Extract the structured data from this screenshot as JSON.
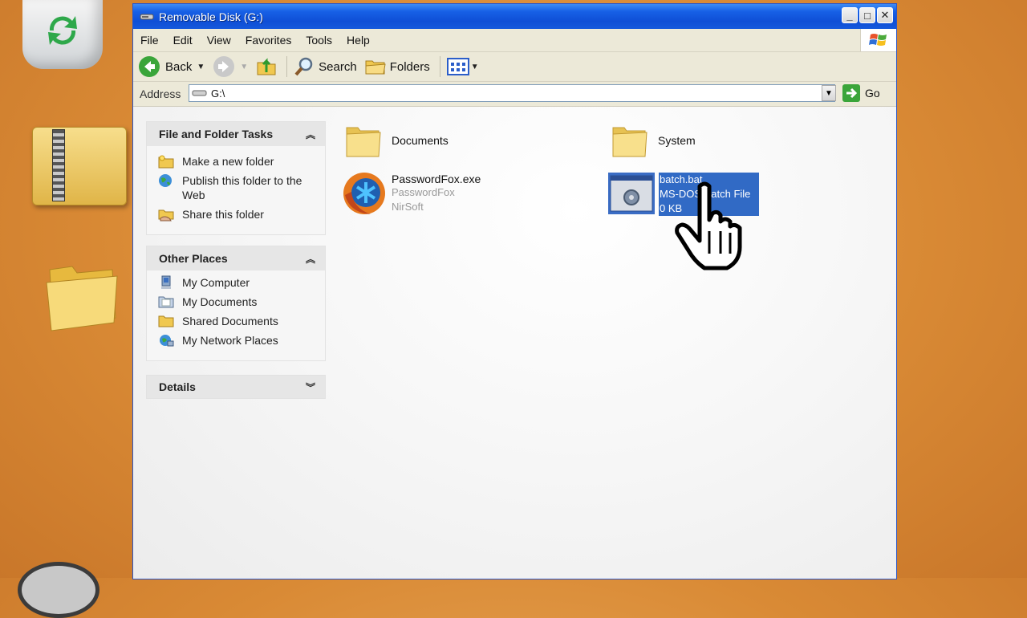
{
  "window": {
    "title": "Removable Disk (G:)"
  },
  "menu": [
    "File",
    "Edit",
    "View",
    "Favorites",
    "Tools",
    "Help"
  ],
  "toolbar": {
    "back_label": "Back",
    "search_label": "Search",
    "folders_label": "Folders"
  },
  "address": {
    "label": "Address",
    "value": "G:\\",
    "go_label": "Go"
  },
  "tasks_panel": {
    "title": "File and Folder Tasks",
    "items": [
      {
        "label": "Make a new folder",
        "icon": "new-folder-icon"
      },
      {
        "label": "Publish this folder to the Web",
        "icon": "globe-icon"
      },
      {
        "label": "Share this folder",
        "icon": "share-folder-icon"
      }
    ]
  },
  "places_panel": {
    "title": "Other Places",
    "items": [
      {
        "label": "My Computer",
        "icon": "computer-icon"
      },
      {
        "label": "My Documents",
        "icon": "documents-folder-icon"
      },
      {
        "label": "Shared Documents",
        "icon": "folder-icon"
      },
      {
        "label": "My Network Places",
        "icon": "network-icon"
      }
    ]
  },
  "details_panel": {
    "title": "Details"
  },
  "files": [
    {
      "name": "Documents",
      "type": "folder"
    },
    {
      "name": "System",
      "type": "folder"
    },
    {
      "name": "PasswordFox.exe",
      "line2": "PasswordFox",
      "line3": "NirSoft",
      "type": "exe"
    },
    {
      "name": "batch.bat",
      "line2": "MS-DOS Batch File",
      "line3": "0 KB",
      "type": "bat",
      "selected": true
    }
  ],
  "colors": {
    "titlebar": "#0f4fd6",
    "selection": "#316ac5",
    "desktop": "#d98a35"
  }
}
